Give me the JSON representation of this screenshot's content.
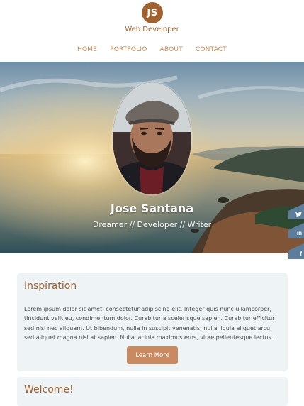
{
  "header": {
    "logo_text": "JS",
    "tagline": "Web Developer",
    "nav": [
      "HOME",
      "PORTFOLIO",
      "ABOUT",
      "CONTACT"
    ]
  },
  "hero": {
    "name": "Jose Santana",
    "subtitle": "Dreamer // Developer // Writer"
  },
  "social": {
    "twitter_icon": "twitter-icon",
    "linkedin_label": "in",
    "facebook_label": "f"
  },
  "sections": {
    "inspiration_title": "Inspiration",
    "inspiration_text": "Lorem ipsum dolor sit amet, consectetur adipiscing elit. Integer quis nunc ullamcorper, tincidunt velit eu, condimentum dolor. Curabitur a scelerisque sapien. Curabitur efficitur sed nisi nec aliquam. Ut bibendum, nulla in suscipit venenatis, nulla ligula aliquet arcu, sed aliquet magna nisi at sapien. Nulla lacinia maximus eros, vitae pellentesque lectus.",
    "learn_more": "Learn More",
    "welcome_title": "Welcome!"
  },
  "colors": {
    "accent": "#a0622f",
    "nav": "#c98a55",
    "button": "#c98a62",
    "card": "#eef3f6",
    "social": "#5d7d9c"
  }
}
